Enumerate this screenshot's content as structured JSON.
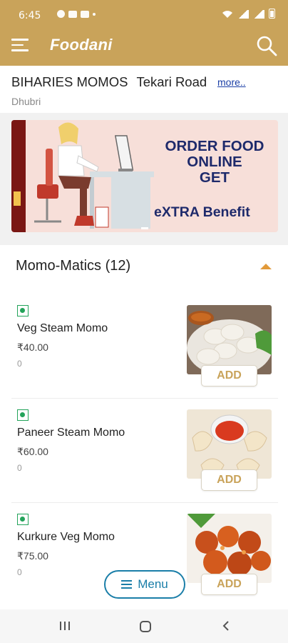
{
  "status_bar": {
    "time": "6:45",
    "left_icons": [
      "settings-icon",
      "gallery-icon",
      "youtube-icon",
      "dot-icon"
    ],
    "right_icons": [
      "wifi-icon",
      "signal-icon",
      "signal-icon",
      "battery-icon"
    ]
  },
  "app_bar": {
    "title": "Foodani",
    "menu_icon": "hamburger-icon",
    "search_icon": "search-icon",
    "color": "#c9a35a"
  },
  "restaurant": {
    "name": "BIHARIES MOMOS",
    "road": "Tekari Road",
    "more_link": "more..",
    "city": "Dhubri"
  },
  "banner": {
    "line1": "ORDER FOOD",
    "line2": "ONLINE",
    "line3": "GET",
    "line4": "eXTRA Benefit"
  },
  "category": {
    "title": "Momo-Matics (12)",
    "expanded": true
  },
  "items": [
    {
      "name": "Veg Steam Momo",
      "price": "₹40.00",
      "count": "0",
      "add_label": "ADD",
      "veg": true
    },
    {
      "name": "Paneer Steam Momo",
      "price": "₹60.00",
      "count": "0",
      "add_label": "ADD",
      "veg": true
    },
    {
      "name": "Kurkure Veg Momo",
      "price": "₹75.00",
      "count": "0",
      "add_label": "ADD",
      "veg": true
    }
  ],
  "floating_menu": {
    "label": "Menu",
    "color": "#1a7ea8"
  },
  "nav_bar": {
    "icons": [
      "recents-icon",
      "home-icon",
      "back-icon"
    ]
  },
  "colors": {
    "accent": "#c9a35a",
    "veg": "#23a35a",
    "link": "#1b3fa6",
    "caret": "#e29a3a"
  }
}
